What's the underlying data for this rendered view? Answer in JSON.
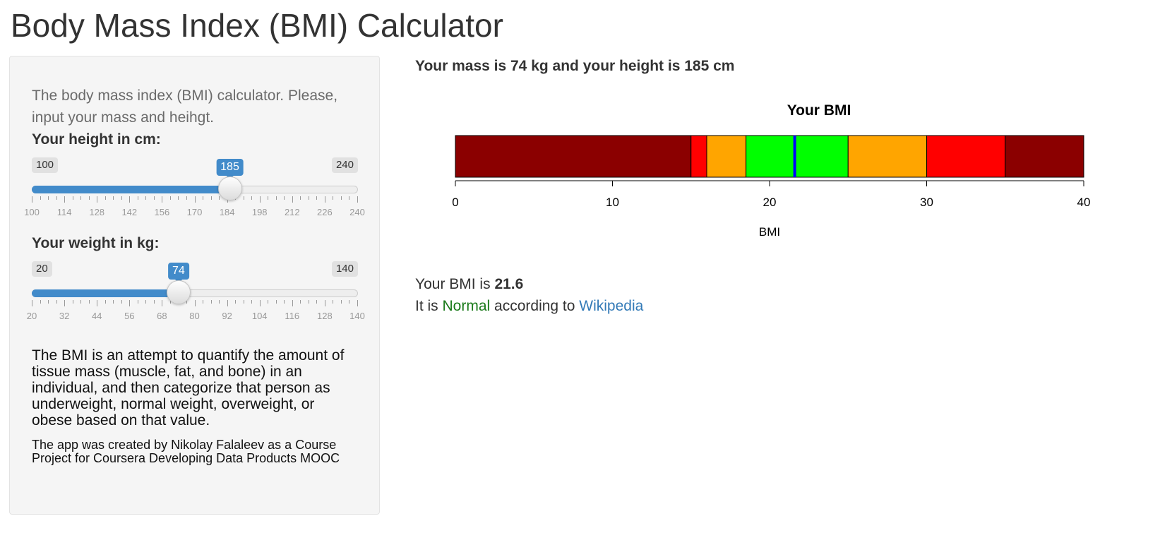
{
  "app": {
    "title": "Body Mass Index (BMI) Calculator"
  },
  "sidebar": {
    "intro": "The body mass index (BMI) calculator. Please, input your mass and heihgt.",
    "height": {
      "label": "Your height in cm:",
      "min": 100,
      "max": 240,
      "value": 185,
      "min_label": "100",
      "max_label": "240",
      "value_label": "185",
      "tick_labels": [
        "100",
        "114",
        "128",
        "142",
        "156",
        "170",
        "184",
        "198",
        "212",
        "226",
        "240"
      ]
    },
    "weight": {
      "label": "Your weight in kg:",
      "min": 20,
      "max": 140,
      "value": 74,
      "min_label": "20",
      "max_label": "140",
      "value_label": "74",
      "tick_labels": [
        "20",
        "32",
        "44",
        "56",
        "68",
        "80",
        "92",
        "104",
        "116",
        "128",
        "140"
      ]
    },
    "description": "The BMI is an attempt to quantify the amount of tissue mass (muscle, fat, and bone) in an individual, and then categorize that person as underweight, normal weight, overweight, or obese based on that value.",
    "credit": "The app was created by Nikolay Falaleev as a Course Project for Coursera Developing Data Products MOOC",
    "colors": {
      "accent": "#428bca",
      "panel": "#f5f5f5"
    }
  },
  "main": {
    "mass_text": "Your mass is 74 kg and your height is 185 cm",
    "bmi_prefix": "Your BMI is ",
    "bmi_value": "21.6",
    "class_prefix": "It is ",
    "category": "Normal",
    "class_middle": " according to ",
    "link_text": "Wikipedia",
    "category_color": "#1a7a1a",
    "link_color": "#337ab7"
  },
  "chart_data": {
    "type": "bar",
    "orientation": "horizontal",
    "title": "Your BMI",
    "xlabel": "BMI",
    "xlim": [
      0,
      40
    ],
    "xticks": [
      0,
      10,
      20,
      30,
      40
    ],
    "tick_labels": [
      "0",
      "10",
      "20",
      "30",
      "40"
    ],
    "segments": [
      {
        "from": 0,
        "to": 15,
        "color": "#8b0000"
      },
      {
        "from": 15,
        "to": 16,
        "color": "#ff0000"
      },
      {
        "from": 16,
        "to": 18.5,
        "color": "#ffa500"
      },
      {
        "from": 18.5,
        "to": 25,
        "color": "#00ff00"
      },
      {
        "from": 25,
        "to": 30,
        "color": "#ffa500"
      },
      {
        "from": 30,
        "to": 35,
        "color": "#ff0000"
      },
      {
        "from": 35,
        "to": 40,
        "color": "#8b0000"
      }
    ],
    "marker": {
      "value": 21.6,
      "color": "#0000ff"
    },
    "grid": false,
    "legend": "none"
  }
}
